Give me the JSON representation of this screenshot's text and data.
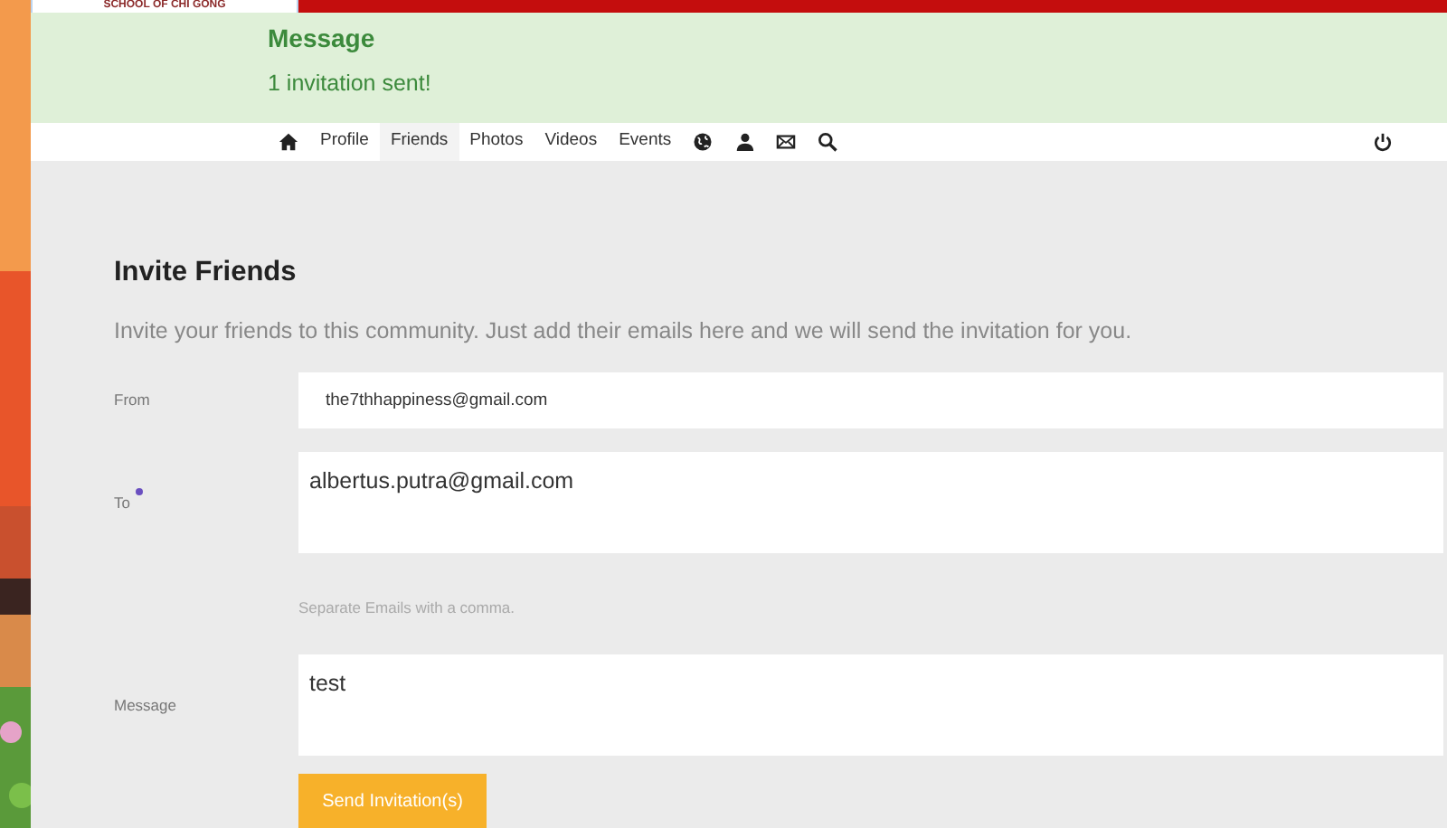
{
  "logo": {
    "text": "SCHOOL OF CHI GONG"
  },
  "message": {
    "title": "Message",
    "text": "1 invitation sent!"
  },
  "nav": {
    "items": [
      {
        "kind": "home",
        "selected": false
      },
      {
        "kind": "text",
        "label": "Profile",
        "selected": false
      },
      {
        "kind": "text",
        "label": "Friends",
        "selected": true
      },
      {
        "kind": "text",
        "label": "Photos",
        "selected": false
      },
      {
        "kind": "text",
        "label": "Videos",
        "selected": false
      },
      {
        "kind": "text",
        "label": "Events",
        "selected": false
      },
      {
        "kind": "globe",
        "selected": false
      },
      {
        "kind": "user",
        "selected": false
      },
      {
        "kind": "mail",
        "selected": false
      },
      {
        "kind": "search",
        "selected": false
      }
    ]
  },
  "form": {
    "title": "Invite Friends",
    "intro": "Invite your friends to this community. Just add their emails here and we will send the invitation for you.",
    "fields": [
      {
        "kind": "line",
        "label": "From",
        "required": false,
        "value": "the7thhappiness@gmail.com"
      },
      {
        "kind": "area",
        "label": "To",
        "required": true,
        "value": "albertus.putra@gmail.com",
        "hint": "Separate Emails with a comma."
      },
      {
        "kind": "area",
        "label": "Message",
        "required": false,
        "value": "test"
      }
    ],
    "submit": "Send Invitation(s)"
  }
}
